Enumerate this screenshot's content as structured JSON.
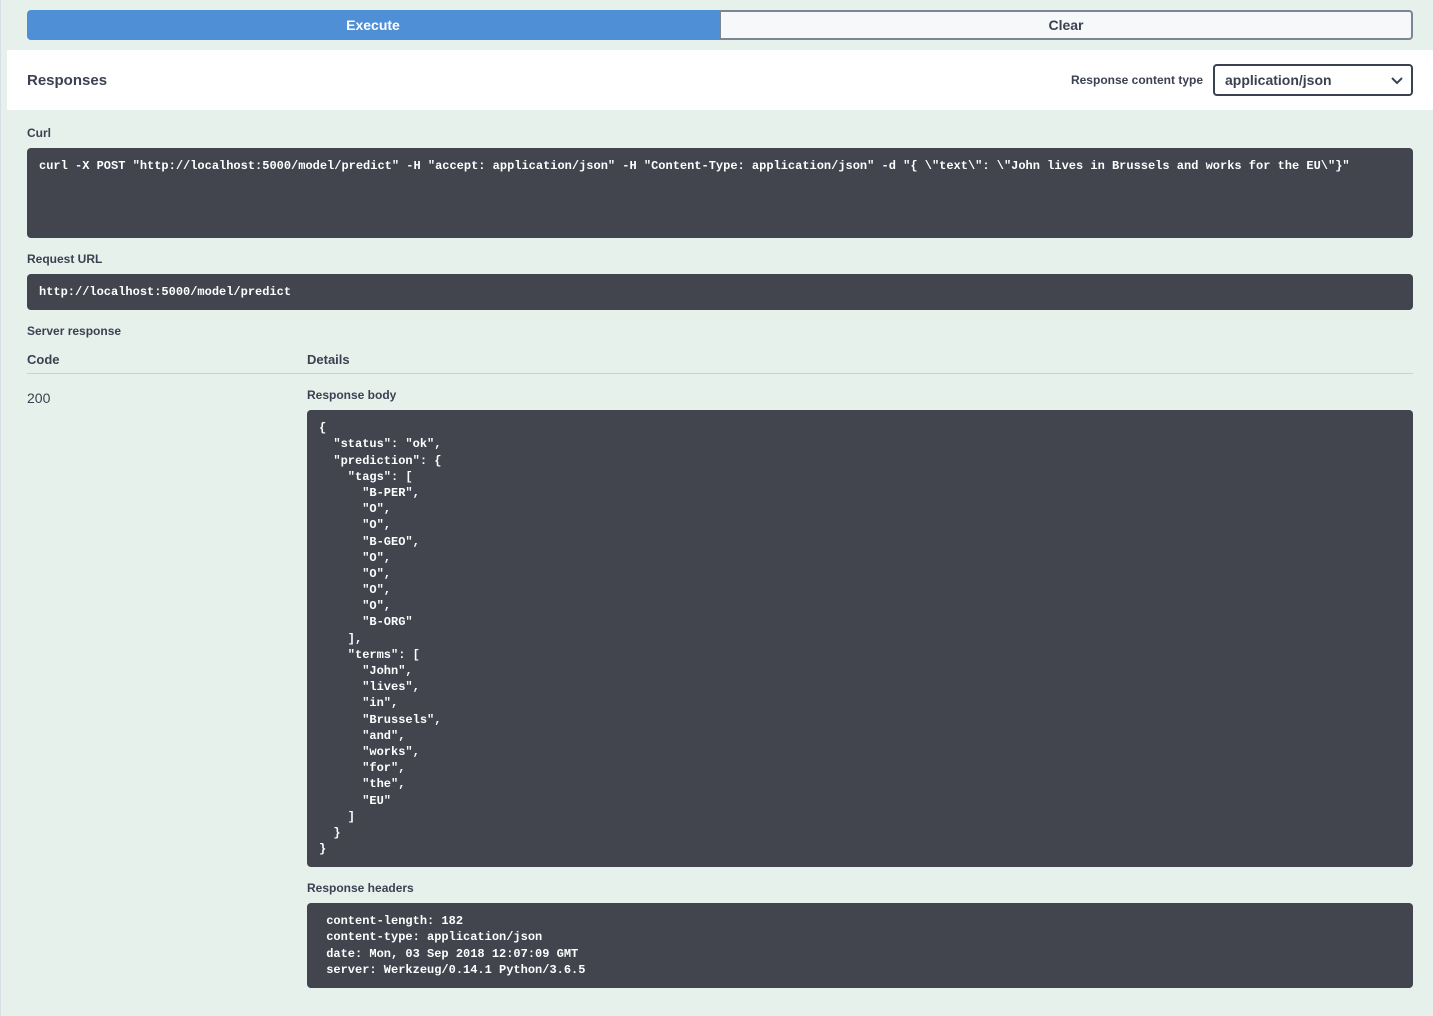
{
  "buttons": {
    "execute": "Execute",
    "clear": "Clear"
  },
  "responses": {
    "title": "Responses",
    "content_type_label": "Response content type",
    "content_type_value": "application/json"
  },
  "curl": {
    "label": "Curl",
    "command": "curl -X POST \"http://localhost:5000/model/predict\" -H \"accept: application/json\" -H \"Content-Type: application/json\" -d \"{ \\\"text\\\": \\\"John lives in Brussels and works for the EU\\\"}\""
  },
  "request_url": {
    "label": "Request URL",
    "value": "http://localhost:5000/model/predict"
  },
  "server_response": {
    "label": "Server response",
    "code_header": "Code",
    "details_header": "Details",
    "code": "200",
    "body_label": "Response body",
    "body": "{\n  \"status\": \"ok\",\n  \"prediction\": {\n    \"tags\": [\n      \"B-PER\",\n      \"O\",\n      \"O\",\n      \"B-GEO\",\n      \"O\",\n      \"O\",\n      \"O\",\n      \"O\",\n      \"B-ORG\"\n    ],\n    \"terms\": [\n      \"John\",\n      \"lives\",\n      \"in\",\n      \"Brussels\",\n      \"and\",\n      \"works\",\n      \"for\",\n      \"the\",\n      \"EU\"\n    ]\n  }\n}",
    "headers_label": "Response headers",
    "headers": " content-length: 182\n content-type: application/json\n date: Mon, 03 Sep 2018 12:07:09 GMT\n server: Werkzeug/0.14.1 Python/3.6.5"
  }
}
